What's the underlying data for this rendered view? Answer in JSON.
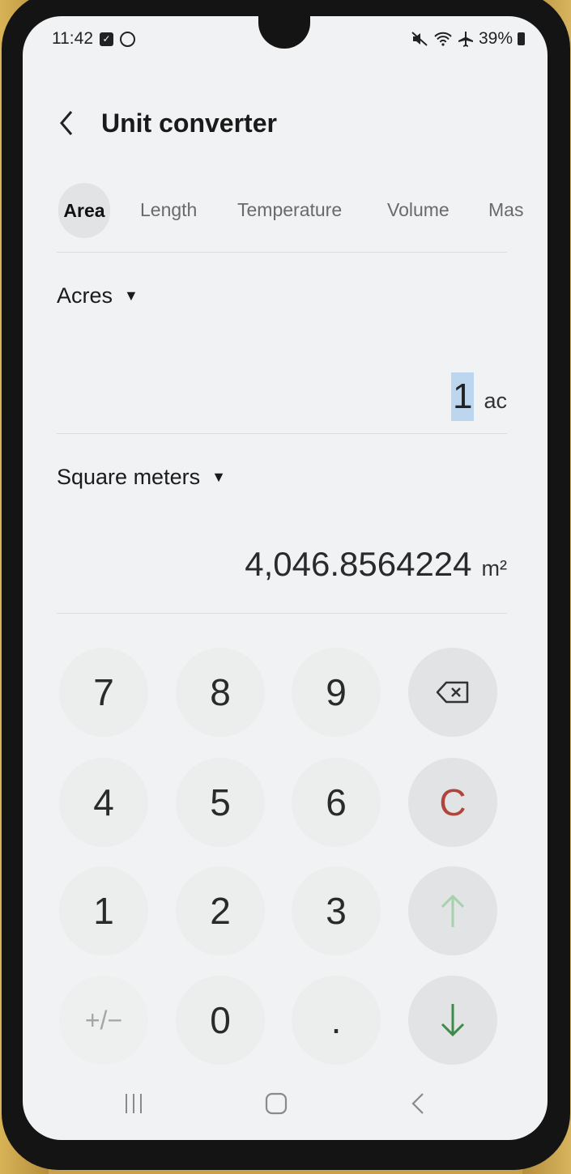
{
  "status_bar": {
    "time": "11:42",
    "battery": "39%"
  },
  "header": {
    "title": "Unit converter"
  },
  "tabs": [
    {
      "label": "Area",
      "active": true
    },
    {
      "label": "Length"
    },
    {
      "label": "Temperature"
    },
    {
      "label": "Volume"
    },
    {
      "label": "Mas"
    }
  ],
  "from": {
    "unit_name": "Acres",
    "value": "1",
    "unit_symbol": "ac"
  },
  "to": {
    "unit_name": "Square meters",
    "value": "4,046.8564224",
    "unit_symbol": "m²"
  },
  "keypad": {
    "k7": "7",
    "k8": "8",
    "k9": "9",
    "k4": "4",
    "k5": "5",
    "k6": "6",
    "k1": "1",
    "k2": "2",
    "k3": "3",
    "plus_minus": "+/−",
    "k0": "0",
    "dot": ".",
    "clear": "C"
  },
  "colors": {
    "clear": "#b0463b",
    "down_arrow": "#3e8a4a",
    "up_arrow_disabled": "#a6d1ad",
    "selected_value_highlight": "#bcd6f0"
  }
}
